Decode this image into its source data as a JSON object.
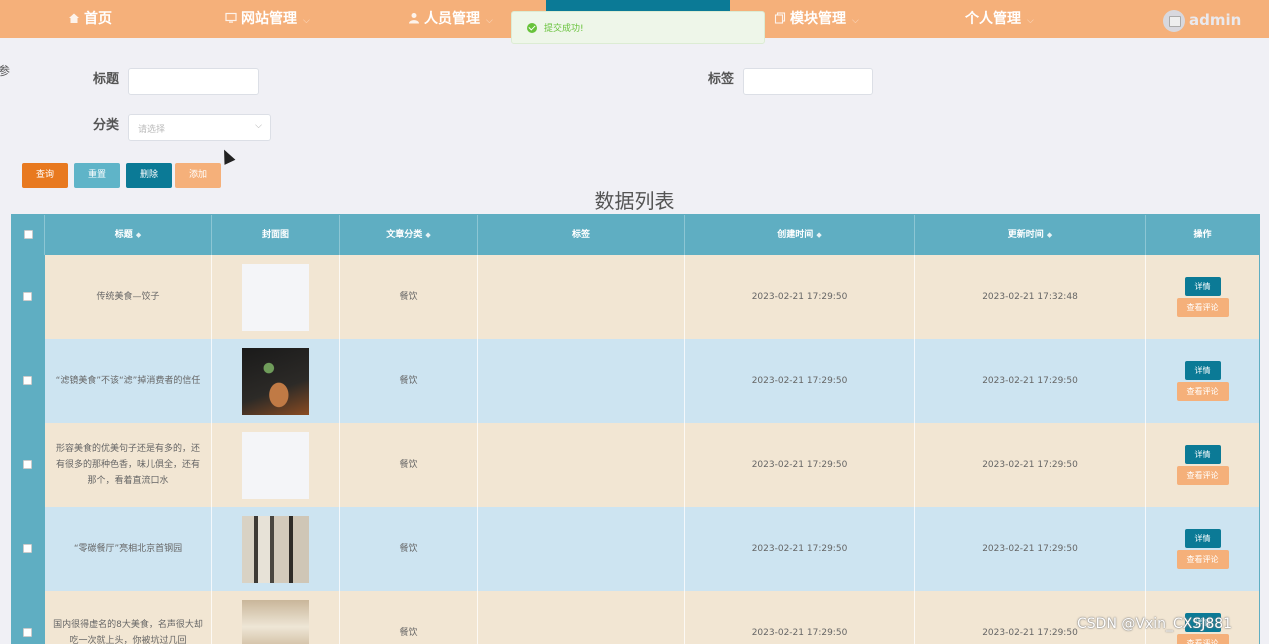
{
  "nav": {
    "items": [
      {
        "label": "首页",
        "icon": "home-icon"
      },
      {
        "label": "网站管理",
        "icon": "monitor-icon"
      },
      {
        "label": "人员管理",
        "icon": "user-icon"
      },
      {
        "label": "模块管理",
        "icon": "copy-icon"
      },
      {
        "label": "个人管理",
        "icon": ""
      }
    ],
    "user": "admin"
  },
  "toast": {
    "message": "提交成功!"
  },
  "edge_text": "参",
  "search": {
    "title_label": "标题",
    "tag_label": "标签",
    "category_label": "分类",
    "category_placeholder": "请选择"
  },
  "buttons": {
    "query": "查询",
    "reset": "重置",
    "delete": "删除",
    "add": "添加"
  },
  "list_title": "数据列表",
  "table": {
    "headers": [
      "标题",
      "封面图",
      "文章分类",
      "标签",
      "创建时间",
      "更新时间",
      "操作"
    ],
    "rows": [
      {
        "title": "传统美食—饺子",
        "category": "餐饮",
        "tag": "",
        "created": "2023-02-21 17:29:50",
        "updated": "2023-02-21 17:32:48",
        "cover": "blank"
      },
      {
        "title": "“滤镜美食”不该“滤”掉消费者的信任",
        "category": "餐饮",
        "tag": "",
        "created": "2023-02-21 17:29:50",
        "updated": "2023-02-21 17:29:50",
        "cover": "dish"
      },
      {
        "title": "形容美食的优美句子还是有多的，还有很多的那种色香，味儿俱全，还有那个，看着直流口水",
        "category": "餐饮",
        "tag": "",
        "created": "2023-02-21 17:29:50",
        "updated": "2023-02-21 17:29:50",
        "cover": "blank"
      },
      {
        "title": "“零碳餐厅”亮相北京首钢园",
        "category": "餐饮",
        "tag": "",
        "created": "2023-02-21 17:29:50",
        "updated": "2023-02-21 17:29:50",
        "cover": "restaurant"
      },
      {
        "title": "国内很得虚名的8大美食，名声很大却吃一次就上头，你被坑过几回",
        "category": "餐饮",
        "tag": "",
        "created": "2023-02-21 17:29:50",
        "updated": "2023-02-21 17:29:50",
        "cover": "restaurant2"
      }
    ],
    "op_detail": "详情",
    "op_comment": "查看评论"
  },
  "watermark": "CSDN @Vxin_CXSJ881",
  "colors": {
    "nav_bg": "#f5b07a",
    "accent_teal": "#0b7a96",
    "header_teal": "#5faec2",
    "query_orange": "#e8791f",
    "reset_cyan": "#5fb4c8",
    "row_tan": "#f2e6d3",
    "row_blue": "#cde4f1",
    "success_green": "#67c23a"
  }
}
